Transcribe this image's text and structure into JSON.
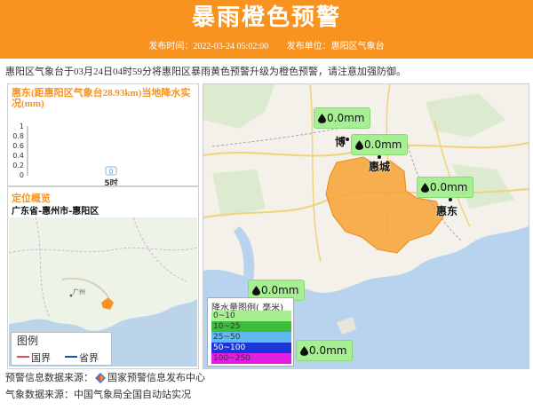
{
  "header": {
    "title": "暴雨橙色预警",
    "publish_time": "发布时间：2022-03-24 05:02:00",
    "publisher": "发布单位：惠阳区气象台"
  },
  "summary": "惠阳区气象台于03月24日04时59分将惠阳区暴雨黄色预警升级为橙色预警，请注意加强防御。",
  "rain_panel": {
    "title": "惠东(距惠阳区气象台28.93km)当地降水实况(mm)",
    "y_ticks": [
      "1",
      "0.8",
      "0.6",
      "0.4",
      "0.2",
      "0"
    ],
    "x_tick": "5时",
    "bar_value_label": "0"
  },
  "chart_data": {
    "type": "bar",
    "categories": [
      "5时"
    ],
    "values": [
      0
    ],
    "title": "惠东(距惠阳区气象台28.93km)当地降水实况(mm)",
    "ylim": [
      0,
      1
    ],
    "grid": false
  },
  "location": {
    "title": "定位概览",
    "region": "广东省-惠州市-惠阳区",
    "legend_title": "图例",
    "legend_country": "国界",
    "legend_province": "省界",
    "legend_colors": {
      "country": "#d9534f",
      "province": "#1f4fb5"
    }
  },
  "map": {
    "bubbles": [
      {
        "value": "0.0mm"
      },
      {
        "value": "0.0mm"
      },
      {
        "value": "0.0mm"
      },
      {
        "value": "0.0mm"
      },
      {
        "value": "0.0mm"
      }
    ],
    "cities": [
      "博",
      "惠城",
      "惠东"
    ],
    "warning_color": "#f7931e",
    "legend": {
      "title": "降水量图例( 毫米)",
      "rows": [
        {
          "label": "0~10",
          "color": "#a6ef92"
        },
        {
          "label": "10~25",
          "color": "#3dbb3d"
        },
        {
          "label": "25~50",
          "color": "#5fb8f0"
        },
        {
          "label": "50~100",
          "color": "#1b35d6"
        },
        {
          "label": "100~250",
          "color": "#e51ee5"
        }
      ]
    }
  },
  "footer": {
    "warning_source_label": "预警信息数据来源：",
    "warning_source": "国家预警信息发布中心",
    "weather_source": "气象数据来源：中国气象局全国自动站实况"
  }
}
